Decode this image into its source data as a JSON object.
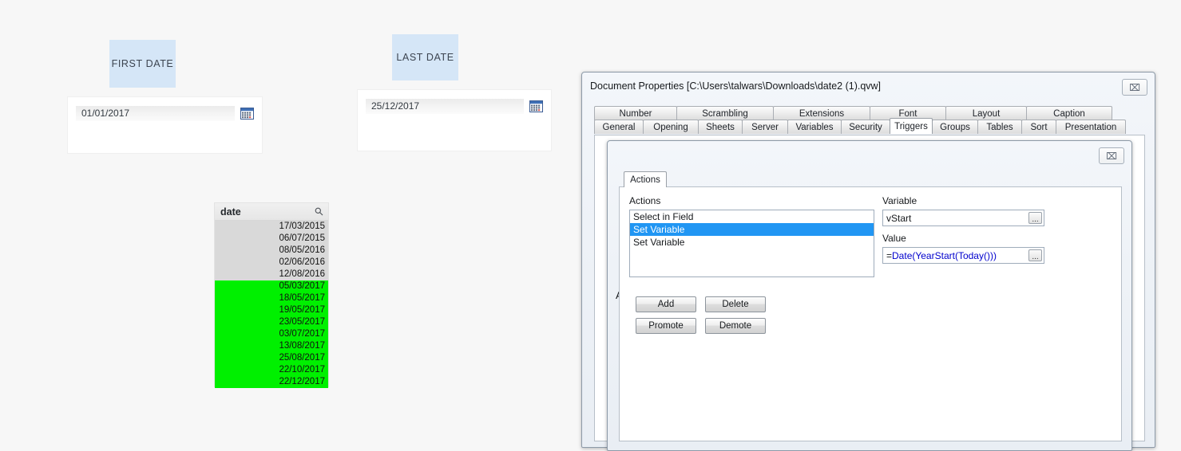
{
  "canvas": {
    "first_date": {
      "label": "FIRST DATE",
      "value": "01/01/2017",
      "calendar_icon": "calendar-icon"
    },
    "last_date": {
      "label": "LAST DATE",
      "value": "25/12/2017",
      "calendar_icon": "calendar-icon"
    },
    "listbox": {
      "title": "date",
      "search_icon": "search-icon",
      "excluded_values": [
        "17/03/2015",
        "06/07/2015",
        "08/05/2016",
        "02/06/2016",
        "12/08/2016"
      ],
      "selected_values": [
        "05/03/2017",
        "18/05/2017",
        "19/05/2017",
        "23/05/2017",
        "03/07/2017",
        "13/08/2017",
        "25/08/2017",
        "22/10/2017",
        "22/12/2017"
      ],
      "colors": {
        "selected_bg": "#00f000",
        "excluded_bg": "#d9d9d9"
      }
    }
  },
  "document_properties": {
    "title": "Document Properties [C:\\Users\\talwars\\Downloads\\date2 (1).qvw]",
    "close_label": "⌧",
    "tabs_row1": [
      "Number",
      "Scrambling",
      "Extensions",
      "Font",
      "Layout",
      "Caption"
    ],
    "tabs_row2": [
      "General",
      "Opening",
      "Sheets",
      "Server",
      "Variables",
      "Security",
      "Triggers",
      "Groups",
      "Tables",
      "Sort",
      "Presentation"
    ],
    "active_tab": "Triggers"
  },
  "actions_dialog": {
    "title": "Actions",
    "close_label": "⌧",
    "tab_label": "Actions",
    "actions_group_label": "Actions",
    "action_items": [
      "Select in Field",
      "Set Variable",
      "Set Variable"
    ],
    "selected_action_index": 1,
    "buttons": {
      "add": "Add",
      "delete": "Delete",
      "promote": "Promote",
      "demote": "Demote"
    },
    "variable_label": "Variable",
    "variable_value": "vStart",
    "value_label": "Value",
    "value_prefix": "=",
    "value_expression": "Date(YearStart(Today()))",
    "ellipsis_label": "...",
    "colors": {
      "selection_blue": "#2196f3",
      "expression_blue": "#0000cd"
    }
  }
}
